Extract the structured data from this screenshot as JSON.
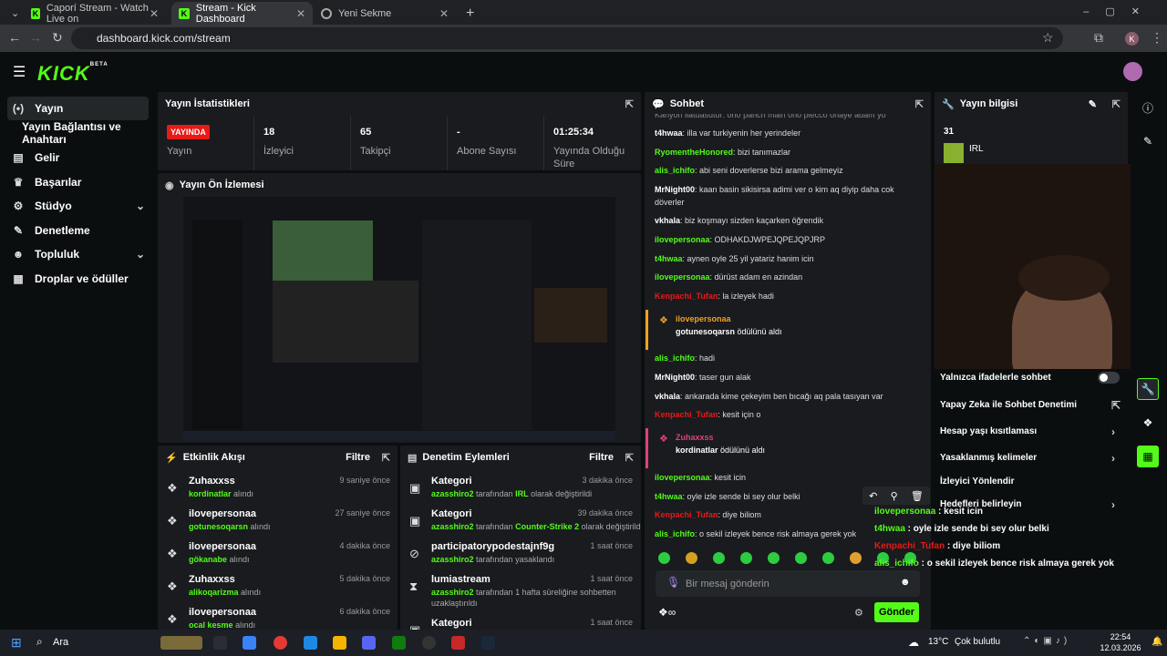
{
  "browser": {
    "tabs": [
      {
        "title": "Caporí Stream - Watch Live on"
      },
      {
        "title": "Stream - Kick Dashboard"
      },
      {
        "title": "Yeni Sekme"
      }
    ],
    "url": "dashboard.kick.com/stream",
    "profile": "K"
  },
  "brand": {
    "logo": "KICK",
    "badge": "BETA"
  },
  "sidebar": {
    "items": [
      {
        "label": "Yayın",
        "icon": "broadcast-icon"
      },
      {
        "label": "Yayın Bağlantısı ve Anahtarı"
      },
      {
        "label": "Gelir",
        "icon": "chart-icon"
      },
      {
        "label": "Başarılar",
        "icon": "trophy-icon"
      },
      {
        "label": "Stüdyo",
        "icon": "studio-icon"
      },
      {
        "label": "Denetleme",
        "icon": "wrench-icon"
      },
      {
        "label": "Topluluk",
        "icon": "people-icon"
      },
      {
        "label": "Droplar ve ödüller",
        "icon": "gift-icon"
      }
    ]
  },
  "stats": {
    "title": "Yayın İstatistikleri",
    "live": "YAYINDA",
    "live_label": "Yayın",
    "viewers": "18",
    "viewers_label": "İzleyici",
    "followers": "65",
    "followers_label": "Takipçi",
    "subs": "-",
    "subs_label": "Abone Sayısı",
    "uptime": "01:25:34",
    "uptime_label": "Yayında Olduğu Süre"
  },
  "preview": {
    "title": "Yayın Ön İzlemesi"
  },
  "activity": {
    "title": "Etkinlik Akışı",
    "filter": "Filtre",
    "suffix": "alındı",
    "items": [
      {
        "user": "Zuhaxxss",
        "reward": "kordinatlar",
        "time": "9 saniye önce"
      },
      {
        "user": "ilovepersonaa",
        "reward": "gotunesoqarsn",
        "time": "27 saniye önce"
      },
      {
        "user": "ilovepersonaa",
        "reward": "gökanabe",
        "time": "4 dakika önce"
      },
      {
        "user": "Zuhaxxss",
        "reward": "alikoqarizma",
        "time": "5 dakika önce"
      },
      {
        "user": "ilovepersonaa",
        "reward": "ocal kesme",
        "time": "6 dakika önce"
      }
    ]
  },
  "moderation": {
    "title": "Denetim Eylemleri",
    "filter": "Filtre",
    "items": [
      {
        "title": "Kategori",
        "mod": "azasshiro2",
        "mid": " tarafından ",
        "val": "IRL",
        "end": " olarak değiştirildi",
        "time": "3 dakika önce"
      },
      {
        "title": "Kategori",
        "mod": "azasshiro2",
        "mid": " tarafından ",
        "val": "Counter-Strike 2",
        "end": " olarak değiştirildi",
        "time": "39 dakika önce"
      },
      {
        "title": "participatorypodestajnf9g",
        "mod": "azasshiro2",
        "mid": " tarafından yasaklandı",
        "val": "",
        "end": "",
        "time": "1 saat önce"
      },
      {
        "title": "lumiastream",
        "mod": "azasshiro2",
        "mid": " tarafından 1 hafta süreliğine sohbetten",
        "val": "",
        "end": "",
        "line2": "uzaklaştırıldı",
        "time": "1 saat önce"
      },
      {
        "title": "Kategori",
        "mod": "",
        "mid": "",
        "val": "",
        "end": "",
        "time": "1 saat önce"
      }
    ]
  },
  "chat": {
    "title": "Sohbet",
    "top_partial": "Kanyon ilatuasutur: ono panch main ono piecco onaye adam yo",
    "messages": [
      {
        "user": "t4hwaa",
        "c": "w",
        "text": ": illa var turkiyenin her yerindeler"
      },
      {
        "user": "RyomentheHonored",
        "c": "g",
        "text": ": bizi tanımazlar"
      },
      {
        "user": "alis_ichifo",
        "c": "g",
        "text": ": abi seni doverlerse bizi arama gelmeyiz"
      },
      {
        "user": "MrNight00",
        "c": "w",
        "text": ": kaan basin sikisirsa adimi ver o kim aq diyip daha cok",
        "line2": "döverler"
      },
      {
        "user": "vkhala",
        "c": "w",
        "text": ": biz koşmayı sizden kaçarken öğrendik"
      },
      {
        "user": "ilovepersonaa",
        "c": "g",
        "text": ": ODHAKDJWPEJQPEJQPJRP"
      },
      {
        "user": "t4hwaa",
        "c": "w",
        "text": ": aynen oyle 25 yil yatariz hanim icin"
      },
      {
        "user": "ilovepersonaa",
        "c": "g",
        "text": ": dürüst adam en azindan"
      },
      {
        "user": "Kenpachi_Tufan",
        "c": "r",
        "text": ": la izleyek hadi"
      },
      {
        "user": "alis_ichifo",
        "c": "g",
        "text": ": hadi"
      },
      {
        "user": "MrNight00",
        "c": "w",
        "text": ": taser gun alak"
      },
      {
        "user": "vkhala",
        "c": "w",
        "text": ": ankarada kime çekeyim ben bıcağı aq pala tasıyan var"
      },
      {
        "user": "Kenpachi_Tufan",
        "c": "r",
        "text": ": kesit için o"
      },
      {
        "user": "ilovepersonaa",
        "c": "g",
        "text": ": kesit icin"
      },
      {
        "user": "t4hwaa",
        "c": "g",
        "text": ": oyle izle sende bi sey olur belki"
      },
      {
        "user": "Kenpachi_Tufan",
        "c": "r",
        "text": ": diye biliom"
      },
      {
        "user": "alis_ichifo",
        "c": "g",
        "text": ": o sekil izleyek bence risk almaya gerek yok"
      }
    ],
    "rewards": [
      {
        "user": "ilovepersonaa",
        "item": "gotunesoqarsn",
        "suffix": " ödülünü aldı",
        "color": "#f0a020"
      },
      {
        "user": "Zuhaxxss",
        "item": "kordinatlar",
        "suffix": " ödülünü aldı",
        "color": "#e0407a"
      }
    ],
    "placeholder": "Bir mesaj gönderin",
    "send": "Gönder"
  },
  "info": {
    "title": "Yayın bilgisi",
    "viewers": "31",
    "category": "IRL"
  },
  "settings": [
    {
      "label": "Yalnızca ifadelerle sohbet"
    },
    {
      "label": "Yapay Zeka ile Sohbet Denetimi"
    },
    {
      "label": "Hesap yaşı kısıtlaması"
    },
    {
      "label": "Yasaklanmış kelimeler"
    },
    {
      "label": "İzleyici Yönlendir"
    },
    {
      "label": "Hedefleri belirleyin"
    }
  ],
  "overlay": [
    {
      "user": "ilovepersonaa",
      "c": "g",
      "text": " : kesit icin"
    },
    {
      "user": "t4hwaa",
      "c": "g",
      "text": " : oyle izle sende bi sey olur belki"
    },
    {
      "user": "Kenpachi_Tufan",
      "c": "r",
      "text": " : diye biliom"
    },
    {
      "user": "alis_ichifo",
      "c": "g",
      "text": " : o sekil izleyek bence risk almaya gerek yok"
    }
  ],
  "taskbar": {
    "search": "Ara",
    "weather": "13°C",
    "weather_text": "Çok bulutlu",
    "time": "22:54",
    "date": "12.03.2026"
  }
}
